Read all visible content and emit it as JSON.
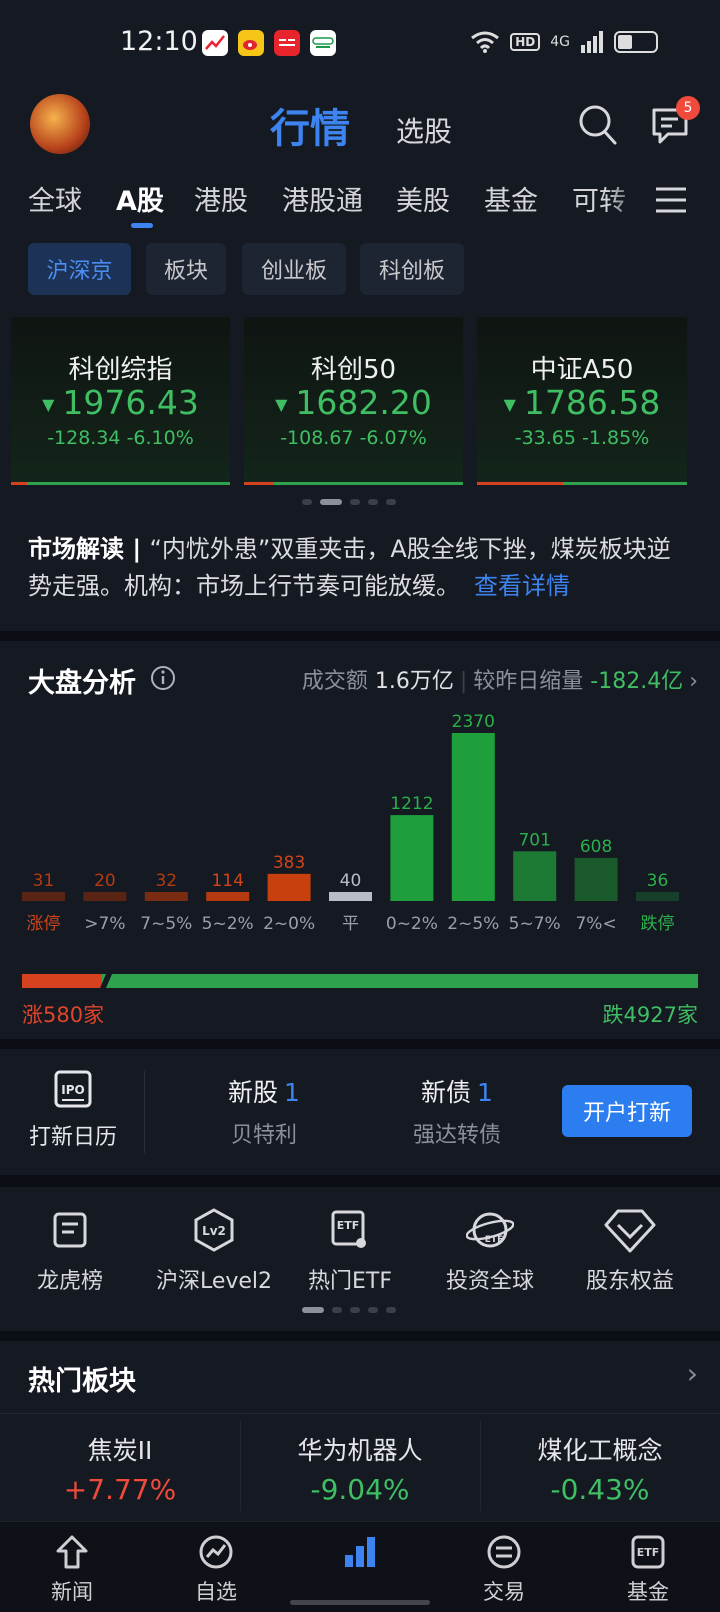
{
  "status_bar": {
    "time": "12:10",
    "hd": "HD",
    "network": "4G",
    "app_icons": [
      "chart-app-icon",
      "weibo-icon",
      "toutiao-icon",
      "oppo-store-icon"
    ]
  },
  "header": {
    "title": "行情",
    "subtitle": "选股",
    "message_badge": "5"
  },
  "market_tabs": [
    "全球",
    "A股",
    "港股",
    "港股通",
    "美股",
    "基金",
    "可转"
  ],
  "sub_tabs": [
    "沪深京",
    "板块",
    "创业板",
    "科创板"
  ],
  "indices": [
    {
      "name": "科创综指",
      "price": "1976.43",
      "change": "-128.34",
      "pct": "-6.10%"
    },
    {
      "name": "科创50",
      "price": "1682.20",
      "change": "-108.67",
      "pct": "-6.07%"
    },
    {
      "name": "中证A50",
      "price": "1786.58",
      "change": "-33.65",
      "pct": "-1.85%"
    }
  ],
  "insight": {
    "label": "市场解读",
    "text": "“内忧外患”双重夹击，A股全线下挫，煤炭板块逆势走强。机构：市场上行节奏可能放缓。",
    "link": "查看详情"
  },
  "analysis": {
    "title": "大盘分析",
    "turnover_label": "成交额",
    "turnover_value": "1.6万亿",
    "compare_label": "较昨日缩量",
    "compare_value": "-182.4亿",
    "up_text": "涨580家",
    "down_text": "跌4927家"
  },
  "chart_data": {
    "type": "bar",
    "categories": [
      "涨停",
      ">7%",
      "7~5%",
      "5~2%",
      "2~0%",
      "平",
      "0~2%",
      "2~5%",
      "5~7%",
      "7%<",
      "跌停"
    ],
    "values": [
      31,
      20,
      32,
      114,
      383,
      40,
      1212,
      2370,
      701,
      608,
      36
    ],
    "bar_colors": [
      "#5a2414",
      "#5a2414",
      "#7a2c12",
      "#b63a10",
      "#c8400e",
      "#b9bcc4",
      "#1f9e3c",
      "#1f9e3c",
      "#1c7a34",
      "#1a5a2a",
      "#17402a"
    ],
    "label_colors": [
      "#b63a10",
      "#b63a10",
      "#b63a10",
      "#d0441a",
      "#d0441a",
      "#b9bcc4",
      "#2bb04a",
      "#2bb04a",
      "#2bb04a",
      "#2bb04a",
      "#2bb04a"
    ],
    "cat_colors": [
      "#d0441a",
      "#9aa0aa",
      "#9aa0aa",
      "#9aa0aa",
      "#9aa0aa",
      "#9aa0aa",
      "#9aa0aa",
      "#9aa0aa",
      "#9aa0aa",
      "#9aa0aa",
      "#2bb04a"
    ],
    "up_count": 580,
    "down_count": 4927
  },
  "ipo": {
    "calendar_label": "打新日历",
    "new_stock_label": "新股",
    "new_stock_count": "1",
    "new_stock_name": "贝特利",
    "new_bond_label": "新债",
    "new_bond_count": "1",
    "new_bond_name": "强达转债",
    "open_button": "开户打新"
  },
  "tools": [
    "龙虎榜",
    "沪深Level2",
    "热门ETF",
    "投资全球",
    "股东权益"
  ],
  "hot_sectors": {
    "title": "热门板块",
    "items": [
      {
        "name": "焦炭II",
        "pct": "+7.77%",
        "color": "#ef4a3c"
      },
      {
        "name": "华为机器人",
        "pct": "-9.04%",
        "color": "#3fbe63"
      },
      {
        "name": "煤化工概念",
        "pct": "-0.43%",
        "color": "#3fbe63"
      }
    ]
  },
  "bottom_nav": [
    "新闻",
    "自选",
    "行情",
    "交易",
    "基金"
  ],
  "colors": {
    "accent": "#3d84f0",
    "up": "#e0452c",
    "down": "#3fbe63"
  }
}
